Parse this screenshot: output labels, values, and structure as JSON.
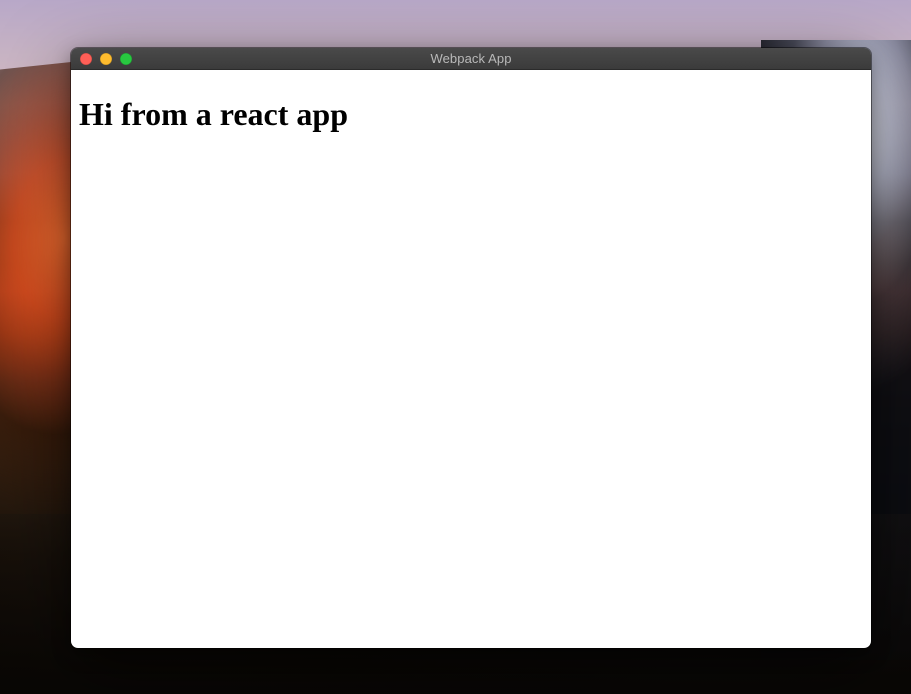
{
  "window": {
    "title": "Webpack App",
    "traffic_lights": {
      "close": "close-icon",
      "minimize": "minimize-icon",
      "maximize": "maximize-icon"
    }
  },
  "content": {
    "heading": "Hi from a react app"
  }
}
